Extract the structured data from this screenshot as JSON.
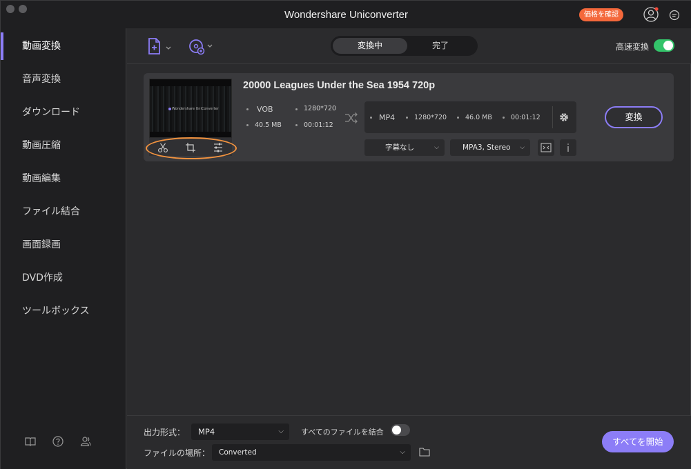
{
  "app": {
    "title": "Wondershare Uniconverter",
    "price_button": "価格を確認"
  },
  "sidebar": {
    "items": [
      {
        "label": "動画変換"
      },
      {
        "label": "音声変換"
      },
      {
        "label": "ダウンロード"
      },
      {
        "label": "動画圧縮"
      },
      {
        "label": "動画編集"
      },
      {
        "label": "ファイル結合"
      },
      {
        "label": "画面録画"
      },
      {
        "label": "DVD作成"
      },
      {
        "label": "ツールボックス"
      }
    ],
    "footer_icons": [
      "book-icon",
      "help-icon",
      "users-icon"
    ]
  },
  "toolbar": {
    "tabs": [
      {
        "label": "変換中"
      },
      {
        "label": "完了"
      }
    ],
    "speed_label": "高速変換",
    "speed_enabled": true
  },
  "file": {
    "title": "20000 Leagues Under the Sea 1954 720p",
    "thumb_text": "Wondershare UniConverter",
    "source": {
      "format": "VOB",
      "resolution": "1280*720",
      "size": "40.5 MB",
      "duration": "00:01:12"
    },
    "target": {
      "format": "MP4",
      "resolution": "1280*720",
      "size": "46.0 MB",
      "duration": "00:01:12"
    },
    "subtitle": "字幕なし",
    "audio": "MPA3, Stereo",
    "convert_label": "変換",
    "edit_icons": [
      "scissors-icon",
      "crop-icon",
      "effects-icon"
    ]
  },
  "bottom": {
    "output_format_label": "出力形式：",
    "output_format": "MP4",
    "merge_label": "すべてのファイルを結合",
    "merge_enabled": false,
    "location_label": "ファイルの場所：",
    "location": "Converted",
    "start_all_label": "すべてを開始"
  },
  "colors": {
    "accent": "#8c7df7",
    "toggle_on": "#33c46a",
    "price": "#f4683b",
    "highlight": "#f3933f"
  }
}
